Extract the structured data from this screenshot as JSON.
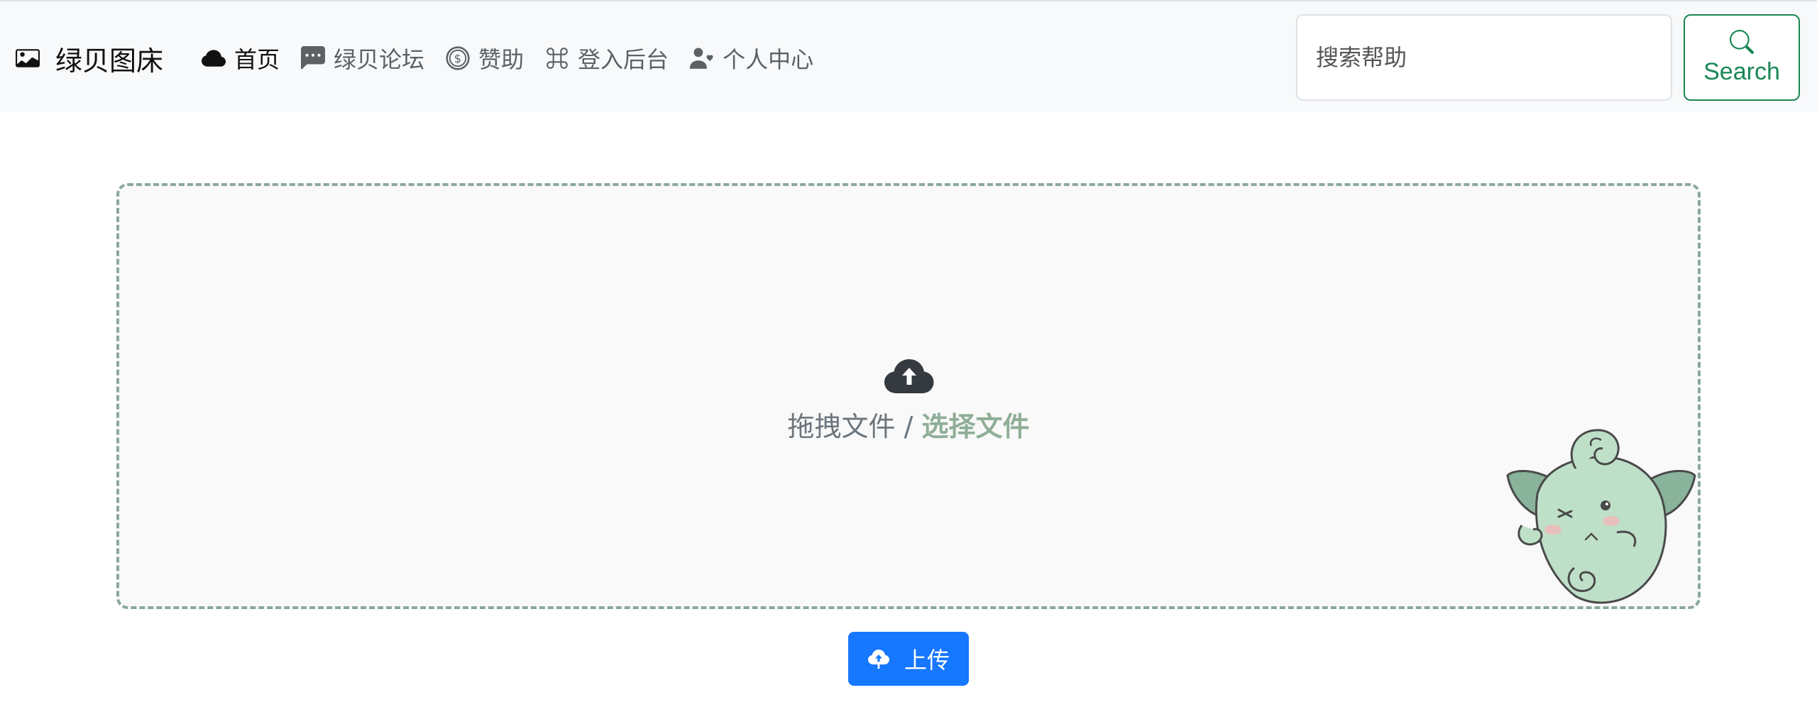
{
  "brand": {
    "title": "绿贝图床",
    "icon": "image-icon"
  },
  "nav": {
    "items": [
      {
        "label": "首页",
        "icon": "cloud-icon",
        "active": true
      },
      {
        "label": "绿贝论坛",
        "icon": "chat-dots-icon",
        "active": false
      },
      {
        "label": "赞助",
        "icon": "coin-icon",
        "active": false
      },
      {
        "label": "登入后台",
        "icon": "command-icon",
        "active": false
      },
      {
        "label": "个人中心",
        "icon": "person-heart-icon",
        "active": false
      }
    ]
  },
  "search": {
    "placeholder": "搜索帮助",
    "button_label": "Search",
    "icon": "search-icon"
  },
  "dropzone": {
    "drag_text": "拖拽文件 / ",
    "select_text": "选择文件",
    "icon": "cloud-upload-icon",
    "mascot": "green-bean-mascot"
  },
  "upload": {
    "label": "上传",
    "icon": "cloud-upload-icon"
  },
  "colors": {
    "navbar_bg": "#f8f9fa",
    "accent_green": "#198754",
    "select_link": "#8fae97",
    "upload_button": "#1677ff"
  }
}
